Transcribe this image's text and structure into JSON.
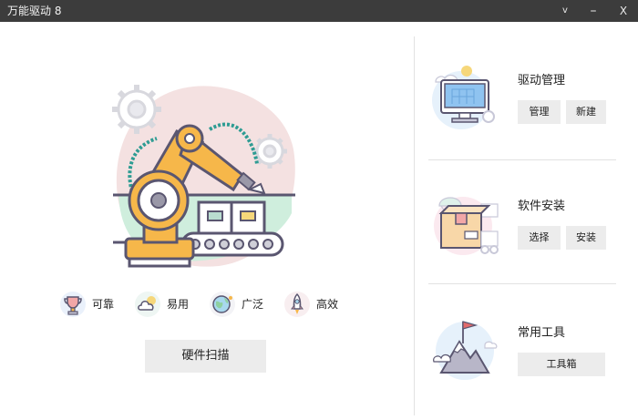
{
  "window": {
    "title": "万能驱动 8",
    "menu_glyph": "v",
    "minimize_glyph": "–",
    "close_glyph": "X"
  },
  "hero": {
    "illustration": "robot-arm-assembly-line-illustration"
  },
  "features": [
    {
      "label": "可靠",
      "icon": "trophy-icon"
    },
    {
      "label": "易用",
      "icon": "cloud-icon"
    },
    {
      "label": "广泛",
      "icon": "globe-icon"
    },
    {
      "label": "高效",
      "icon": "rocket-icon"
    }
  ],
  "scan_button": {
    "label": "硬件扫描"
  },
  "cards": {
    "driver": {
      "title": "驱动管理",
      "icon": "monitor-icon",
      "buttons": [
        "管理",
        "新建"
      ]
    },
    "software": {
      "title": "软件安装",
      "icon": "package-icon",
      "buttons": [
        "选择",
        "安装"
      ]
    },
    "tools": {
      "title": "常用工具",
      "icon": "mountain-flag-icon",
      "buttons": [
        "工具箱"
      ]
    }
  },
  "colors": {
    "titlebar": "#3c3c3c",
    "button_bg": "#ececec",
    "robot_orange": "#f6b74a",
    "outline": "#5a5670",
    "accent_teal": "#2e9c93",
    "blob_pink": "#f4e1e1",
    "blob_green": "#cfeedd"
  }
}
